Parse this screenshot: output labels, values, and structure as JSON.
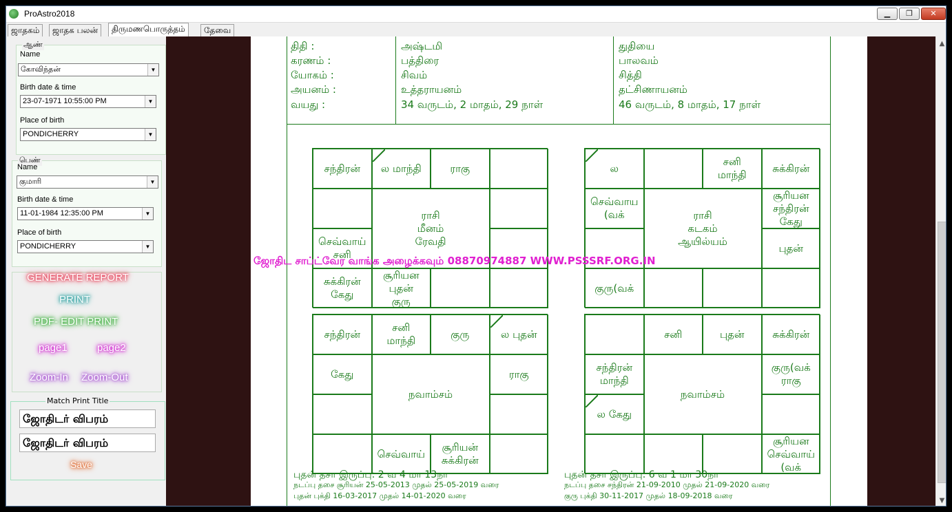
{
  "window": {
    "title": "ProAstro2018",
    "minimize": "▁",
    "restore": "❐",
    "close": "✕"
  },
  "tabs": [
    "ஜாதகம்",
    "ஜாதக பலன்",
    "திருமணபொருத்தம்",
    "தேவை"
  ],
  "male": {
    "legend": "ஆண்",
    "name_label": "Name",
    "name_value": "கோவிந்தன்",
    "birth_label": "Birth date & time",
    "birth_value": "23-07-1971 10:55:00 PM",
    "place_label": "Place of birth",
    "place_value": "PONDICHERRY"
  },
  "female": {
    "legend": "பெண்",
    "name_label": "Name",
    "name_value": "குமாரி",
    "birth_label": "Birth date & time",
    "birth_value": "11-01-1984 12:35:00 PM",
    "place_label": "Place of birth",
    "place_value": "PONDICHERRY"
  },
  "buttons": {
    "generate": "GENERATE REPORT",
    "print": "PRINT",
    "pdf": "PDF- EDIT PRINT",
    "page1": "page1",
    "page2": "page2",
    "zoom_in": "Zoom-In",
    "zoom_out": "Zoom-Out",
    "save": "Save"
  },
  "colors": {
    "generate": "#e8304a",
    "print": "#1a9a9a",
    "pdf": "#2aaa2a",
    "page": "#d020d0",
    "zoom": "#a040d0",
    "save": "#e06020"
  },
  "match_print": {
    "legend": "Match Print Title",
    "title1": "ஜோதிடர் விபரம்",
    "title2": "ஜோதிடர் விபரம்"
  },
  "details": {
    "labels": [
      "திதி :",
      "கரணம் :",
      "யோகம் :",
      "அயனம் :",
      "வயது :"
    ],
    "male": [
      "அஷ்டமி",
      "பத்திரை",
      "சிவம்",
      "உத்தராயனம்",
      "34 வருடம், 2 மாதம், 29 நாள்"
    ],
    "female": [
      "துதியை",
      "பாலவம்",
      "சித்தி",
      "தட்சிணாயனம்",
      "46 வருடம், 8 மாதம், 17 நாள்"
    ]
  },
  "charts": {
    "male_rasi": {
      "center": [
        "ராசி",
        "மீனம்",
        "ரேவதி"
      ],
      "cells": [
        "சந்திரன்",
        "ல மாந்தி",
        "ராகு",
        "",
        "",
        "",
        "",
        "",
        "சூரியன\nபுதன்\nகுரு",
        "சுக்கிரன்\nகேது",
        "செவ்வாய்\nசனி",
        ""
      ]
    },
    "female_rasi": {
      "center": [
        "ராசி",
        "கடகம்",
        "ஆயில்யம்"
      ],
      "cells": [
        "ல",
        "",
        "சனி\nமாந்தி",
        "சுக்கிரன்",
        "சூரியன\nசந்திரன்\nகேது",
        "புதன்",
        "",
        "",
        "",
        "குரு(வக்",
        "",
        "செவ்வாய\n(வக்"
      ]
    },
    "male_navamsa": {
      "center": [
        "நவாம்சம்"
      ],
      "cells": [
        "சந்திரன்",
        "சனி\nமாந்தி",
        "குரு",
        "ல புதன்",
        "ராகு",
        "",
        "",
        "சூரியன்\nசுக்கிரன்",
        "செவ்வாய்",
        "",
        "",
        "கேது"
      ]
    },
    "female_navamsa": {
      "center": [
        "நவாம்சம்"
      ],
      "cells": [
        "",
        "சனி",
        "புதன்",
        "சுக்கிரன்",
        "குரு(வக்\nராகு",
        "",
        "சூரியன\nசெவ்வாய்\n(வக்",
        "",
        "",
        "",
        "ல கேது",
        "சந்திரன்\nமாந்தி"
      ]
    }
  },
  "watermark": "ஜோதிட சாப்ட்வேர வாங்க அழைக்கவும் 08870974887  WWW.PSSSRF.ORG.IN",
  "dasa": {
    "male": [
      "புதன் தசா இருப்பு: 2 வ 4 மா 13நா",
      "நடப்பு தசை சூரியன் 25-05-2013 முதல் 25-05-2019 வரை",
      "புதன் புக்தி 16-03-2017 முதல் 14-01-2020 வரை"
    ],
    "female": [
      "புதன் தசா இருப்பு: 6 வ 1 மா 30நா",
      "நடப்பு தசை சந்திரன் 21-09-2010 முதல் 21-09-2020 வரை",
      "குரு புக்தி 30-11-2017 முதல் 18-09-2018 வரை"
    ]
  }
}
